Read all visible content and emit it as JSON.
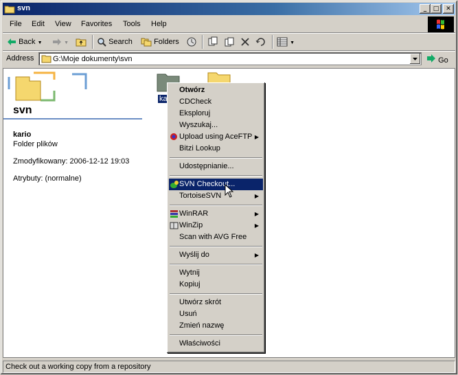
{
  "window": {
    "title": "svn"
  },
  "titlebar_buttons": {
    "minimize": "_",
    "maximize": "□",
    "close": "✕"
  },
  "menubar": {
    "items": [
      "File",
      "Edit",
      "View",
      "Favorites",
      "Tools",
      "Help"
    ]
  },
  "toolbar": {
    "back_label": "Back",
    "search_label": "Search",
    "folders_label": "Folders"
  },
  "address": {
    "label": "Address",
    "value": "G:\\Moje dokumenty\\svn",
    "go_label": "Go"
  },
  "content": {
    "folder_title": "svn",
    "selected_name": "kario",
    "selected_type": "Folder plików",
    "modified": "Zmodyfikowany: 2006-12-12 19:03",
    "attributes": "Atrybuty: (normalne)",
    "icon_label_fragment": "ka"
  },
  "context_menu": {
    "groups": [
      [
        "Otwórz",
        "CDCheck",
        "Eksploruj",
        "Wyszukaj...",
        "Upload using AceFTP",
        "Bitzi Lookup"
      ],
      [
        "Udostępnianie..."
      ],
      [
        "SVN Checkout...",
        "TortoiseSVN"
      ],
      [
        "WinRAR",
        "WinZip",
        "Scan with AVG Free"
      ],
      [
        "Wyślij do"
      ],
      [
        "Wytnij",
        "Kopiuj"
      ],
      [
        "Utwórz skrót",
        "Usuń",
        "Zmień nazwę"
      ],
      [
        "Właściwości"
      ]
    ]
  },
  "status": {
    "text": "Check out a working copy from a repository"
  },
  "colors": {
    "titlebar": "#0a246a",
    "highlight": "#0a246a",
    "face": "#d4d0c8"
  }
}
